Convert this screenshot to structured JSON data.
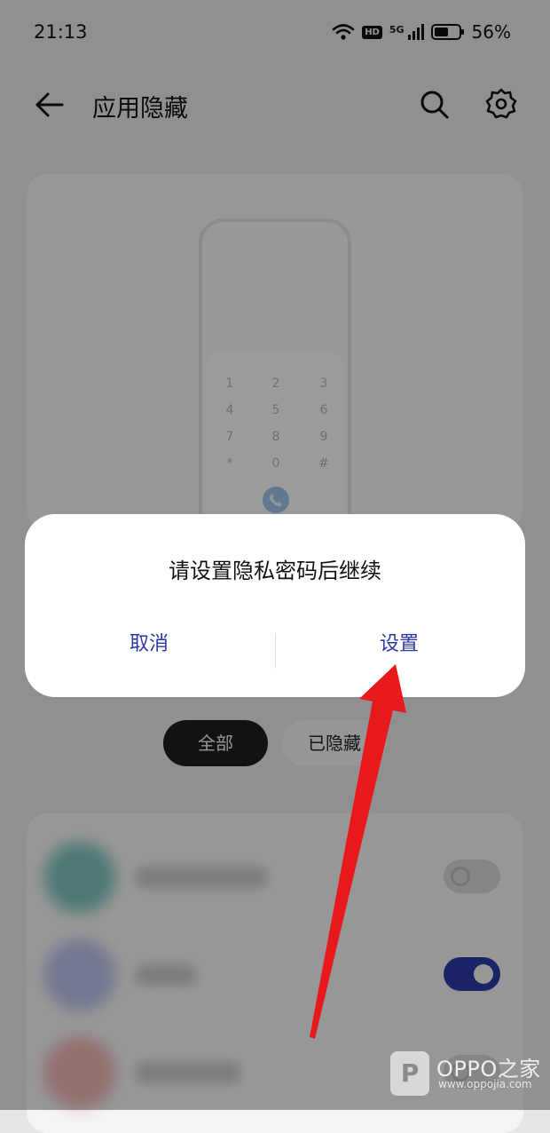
{
  "status_bar": {
    "time": "21:13",
    "network_badge": "HD",
    "signal_label": "5G",
    "battery_percent": "56%",
    "battery_level": 0.56
  },
  "header": {
    "title": "应用隐藏",
    "back_icon": "arrow-left-icon",
    "search_icon": "search-icon",
    "settings_icon": "gear-icon"
  },
  "illustration": {
    "keypad_keys": [
      "1",
      "2",
      "3",
      "4",
      "5",
      "6",
      "7",
      "8",
      "9",
      "*",
      "0",
      "#"
    ],
    "call_icon": "phone-icon"
  },
  "filters": {
    "all_label": "全部",
    "hidden_label": "已隐藏"
  },
  "app_list": {
    "toggles": [
      false,
      true,
      false
    ]
  },
  "dialog": {
    "message": "请设置隐私密码后继续",
    "cancel_label": "取消",
    "confirm_label": "设置"
  },
  "watermark": {
    "logo_letter": "P",
    "brand": "OPPO之家",
    "url": "www.oppojia.com"
  },
  "colors": {
    "accent": "#2b3aa3",
    "toggle_on": "#2a3aa6",
    "arrow": "#e8191c"
  }
}
